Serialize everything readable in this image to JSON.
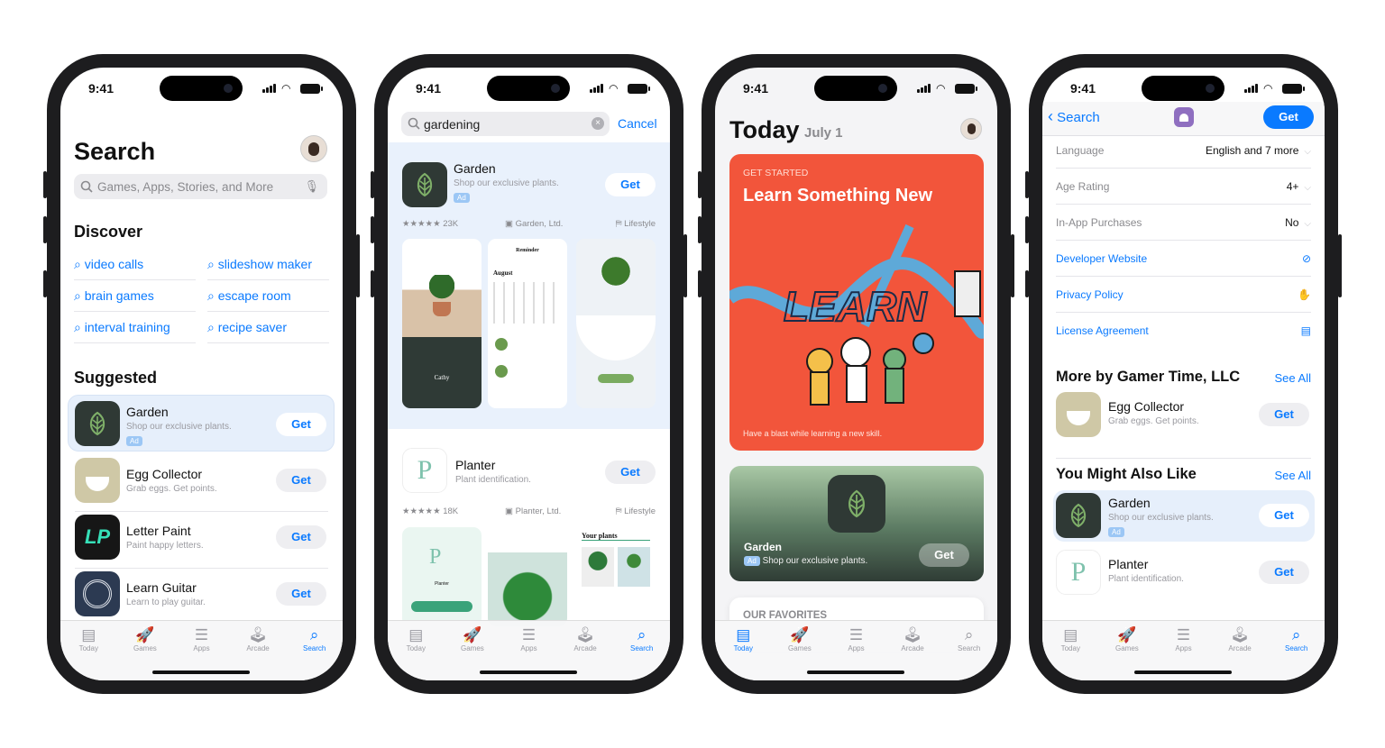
{
  "status_time": "9:41",
  "tabs": [
    {
      "label": "Today",
      "icon": "today-icon",
      "glyph": "▤"
    },
    {
      "label": "Games",
      "icon": "rocket-icon",
      "glyph": "🚀"
    },
    {
      "label": "Apps",
      "icon": "apps-stack-icon",
      "glyph": "☰"
    },
    {
      "label": "Arcade",
      "icon": "joystick-icon",
      "glyph": "🕹"
    },
    {
      "label": "Search",
      "icon": "search-icon",
      "glyph": "⌕"
    }
  ],
  "colors": {
    "accent": "#0a7aff",
    "featured_card": "#f2553b",
    "ad_highlight": "#e6effb"
  },
  "phone1": {
    "title": "Search",
    "search_placeholder": "Games, Apps, Stories, and More",
    "discover_title": "Discover",
    "discover": [
      "video calls",
      "slideshow maker",
      "brain games",
      "escape room",
      "interval training",
      "recipe saver"
    ],
    "suggested_title": "Suggested",
    "suggested": [
      {
        "name": "Garden",
        "subtitle": "Shop our exclusive plants.",
        "badge": "Ad",
        "button": "Get"
      },
      {
        "name": "Egg Collector",
        "subtitle": "Grab eggs. Get points.",
        "button": "Get"
      },
      {
        "name": "Letter Paint",
        "subtitle": "Paint happy letters.",
        "button": "Get",
        "icon_text": "LP"
      },
      {
        "name": "Learn Guitar",
        "subtitle": "Learn to play guitar.",
        "button": "Get"
      }
    ],
    "active_tab": "Search"
  },
  "phone2": {
    "search_value": "gardening",
    "cancel": "Cancel",
    "results": [
      {
        "name": "Garden",
        "subtitle": "Shop our exclusive plants.",
        "badge": "Ad",
        "button": "Get",
        "rating": "★★★★★ 23K",
        "developer": "Garden, Ltd.",
        "category": "Lifestyle",
        "screens": [
          "Cathy",
          "Reminder",
          "August"
        ]
      },
      {
        "name": "Planter",
        "subtitle": "Plant identification.",
        "button": "Get",
        "rating": "★★★★★ 18K",
        "developer": "Planter, Ltd.",
        "category": "Lifestyle",
        "icon_text": "P",
        "screens": [
          "Planter",
          "Your plants"
        ]
      }
    ],
    "active_tab": "Search"
  },
  "phone3": {
    "title": "Today",
    "date": "July 1",
    "featured": {
      "eyebrow": "GET STARTED",
      "title": "Learn Something New",
      "caption": "Have a blast while learning a new skill.",
      "art_text": "LEARN"
    },
    "ad_card": {
      "name": "Garden",
      "badge": "Ad",
      "subtitle": "Shop our exclusive plants.",
      "button": "Get"
    },
    "favorites": "OUR FAVORITES",
    "active_tab": "Today"
  },
  "phone4": {
    "back": "Search",
    "button": "Get",
    "info": [
      {
        "label": "Language",
        "value": "English and 7 more"
      },
      {
        "label": "Age Rating",
        "value": "4+"
      },
      {
        "label": "In-App Purchases",
        "value": "No"
      }
    ],
    "links": [
      {
        "label": "Developer Website",
        "icon": "compass-icon",
        "glyph": "⊘"
      },
      {
        "label": "Privacy Policy",
        "icon": "hand-icon",
        "glyph": "✋"
      },
      {
        "label": "License Agreement",
        "icon": "document-icon",
        "glyph": "▤"
      }
    ],
    "more_by": {
      "title": "More by Gamer Time, LLC",
      "see_all": "See All",
      "apps": [
        {
          "name": "Egg Collector",
          "subtitle": "Grab eggs. Get points.",
          "button": "Get"
        }
      ]
    },
    "also_like": {
      "title": "You Might Also Like",
      "see_all": "See All",
      "apps": [
        {
          "name": "Garden",
          "subtitle": "Shop our exclusive plants.",
          "badge": "Ad",
          "button": "Get"
        },
        {
          "name": "Planter",
          "subtitle": "Plant identification.",
          "button": "Get",
          "icon_text": "P"
        }
      ]
    },
    "active_tab": "Search"
  }
}
